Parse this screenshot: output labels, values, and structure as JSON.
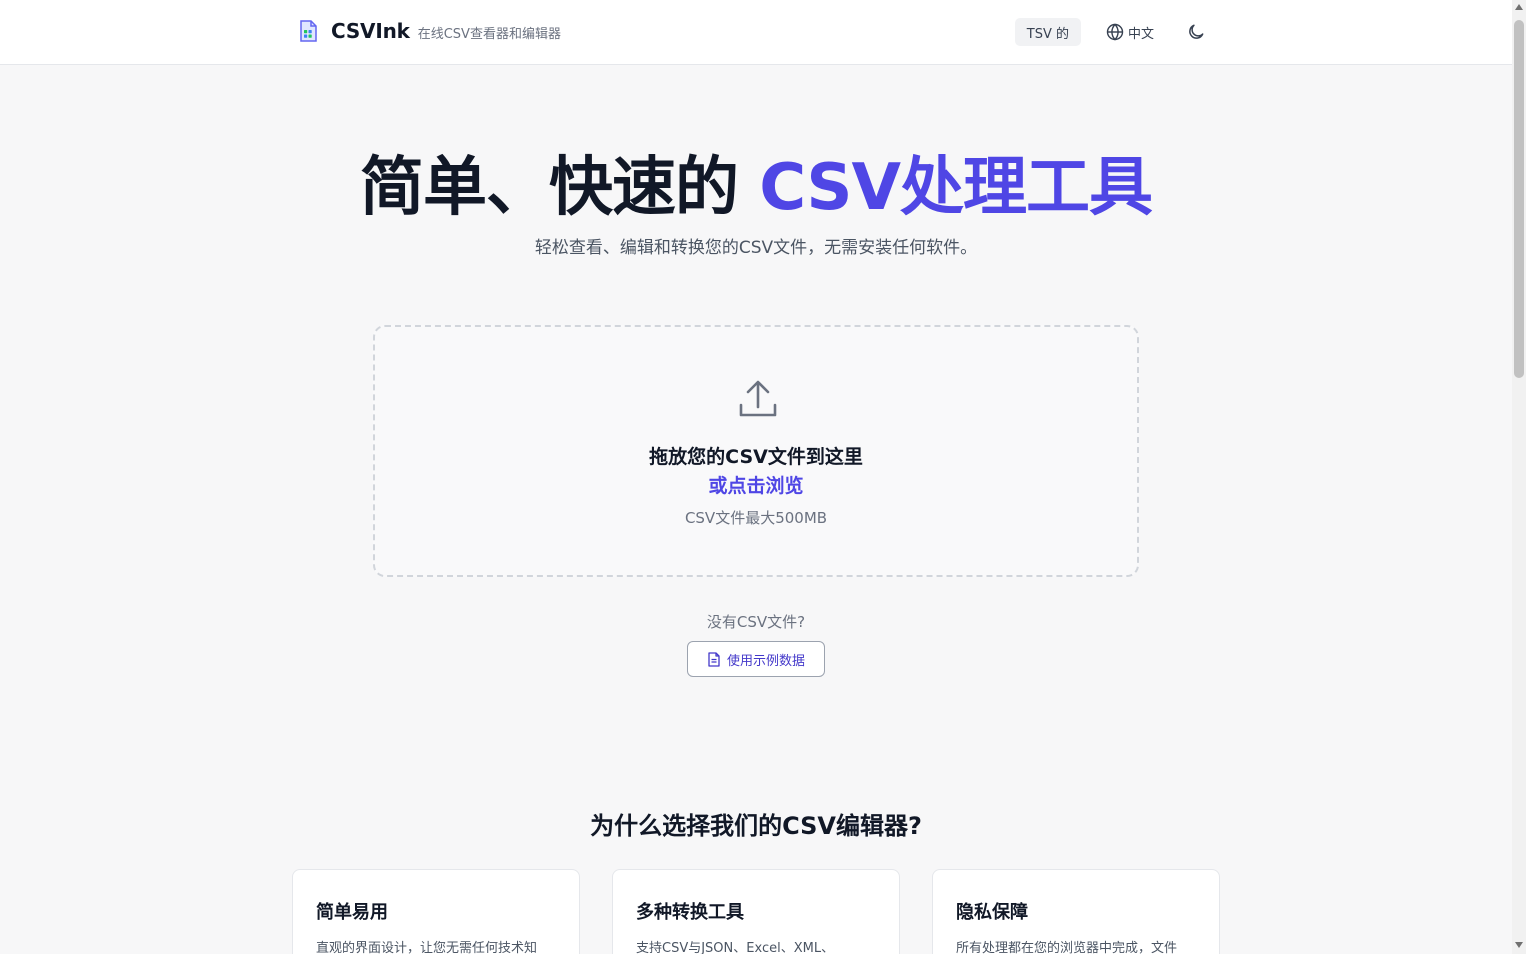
{
  "header": {
    "brand_name": "CSVInk",
    "brand_subtitle": "在线CSV查看器和编辑器",
    "tsv_label": "TSV 的",
    "lang_label": "中文"
  },
  "hero": {
    "title_plain": "简单、快速的 ",
    "title_accent": "CSV处理工具",
    "subtitle": "轻松查看、编辑和转换您的CSV文件，无需安装任何软件。"
  },
  "dropzone": {
    "title": "拖放您的CSV文件到这里",
    "browse_label": "或点击浏览",
    "limit_text": "CSV文件最大500MB"
  },
  "sample": {
    "question": "没有CSV文件?",
    "button_label": "使用示例数据"
  },
  "why": {
    "title": "为什么选择我们的CSV编辑器?",
    "cards": [
      {
        "title": "简单易用",
        "text": "直观的界面设计，让您无需任何技术知"
      },
      {
        "title": "多种转换工具",
        "text": "支持CSV与JSON、Excel、XML、"
      },
      {
        "title": "隐私保障",
        "text": "所有处理都在您的浏览器中完成，文件"
      }
    ]
  },
  "colors": {
    "accent": "#4f46e5",
    "text_dark": "#111827",
    "text_muted": "#6b7280",
    "background": "#f7f7f8"
  },
  "icons": [
    "csv-file-logo-icon",
    "globe-icon",
    "moon-icon",
    "upload-icon",
    "document-icon"
  ]
}
